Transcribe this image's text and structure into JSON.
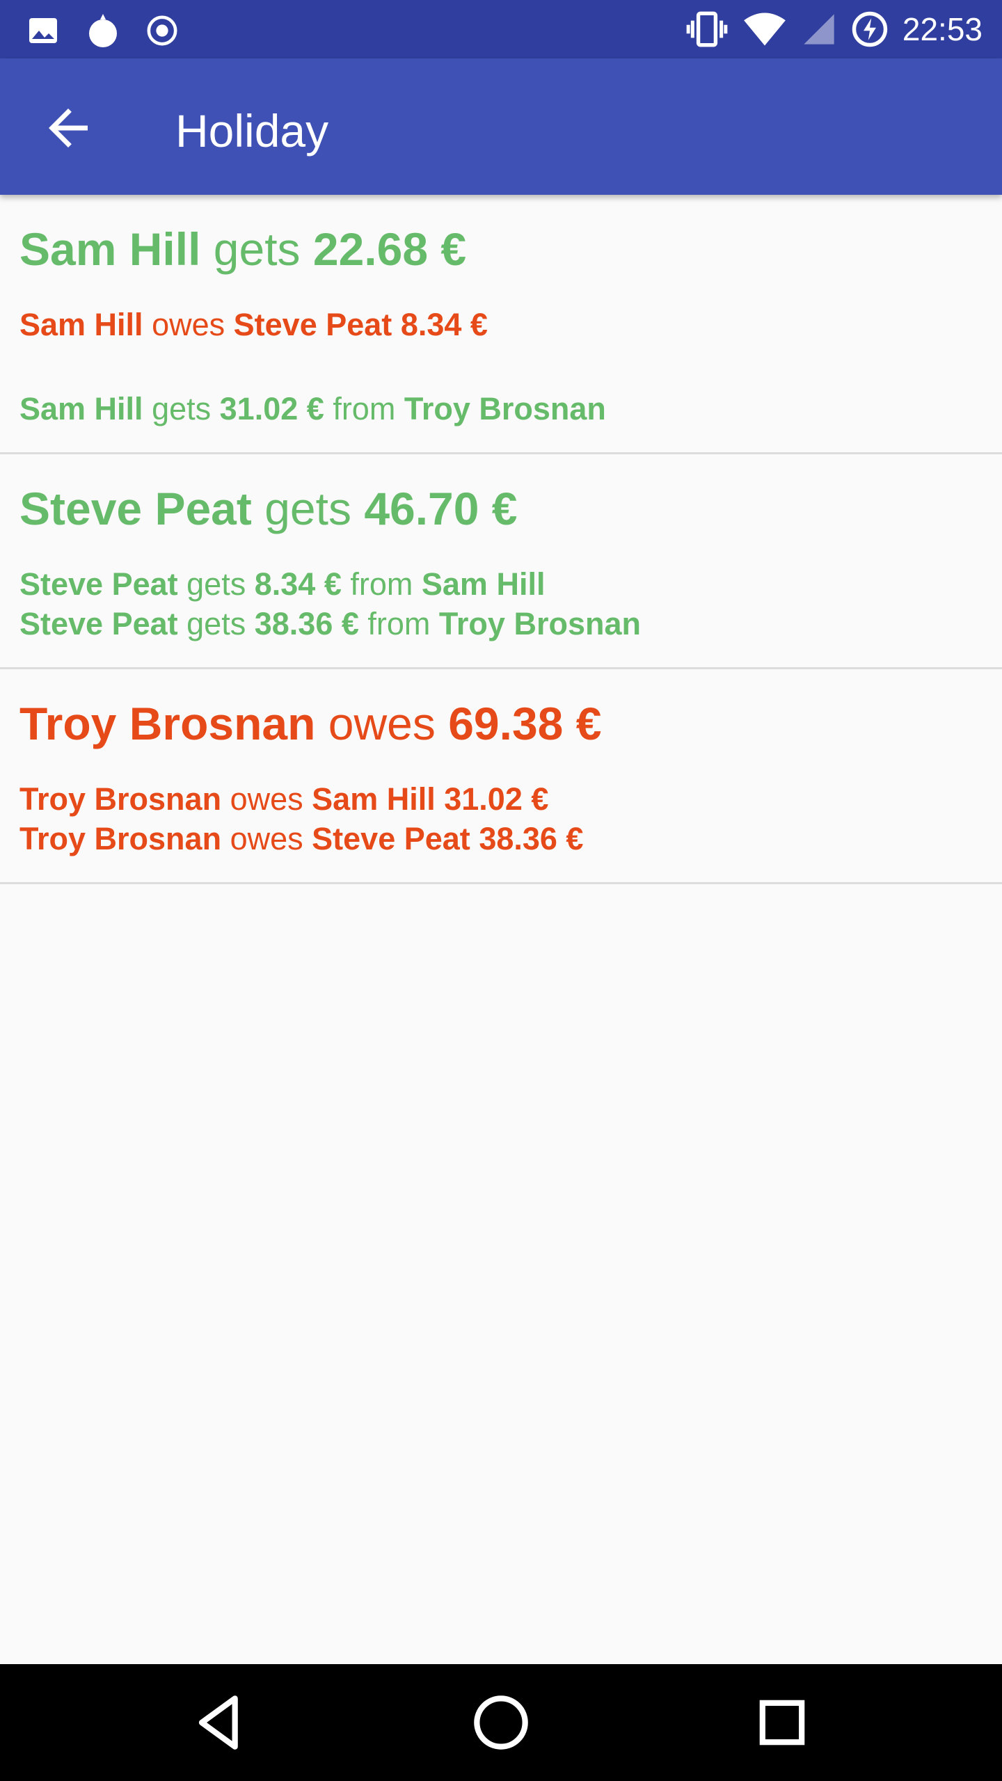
{
  "status_bar": {
    "time": "22:53",
    "left_icons": [
      "image-icon",
      "pomegranate-icon",
      "record-icon"
    ],
    "right_icons": [
      "vibrate-icon",
      "wifi-icon",
      "signal-icon",
      "battery-charging-icon"
    ]
  },
  "app_bar": {
    "title": "Holiday",
    "back_icon": "arrow-back-icon"
  },
  "colors": {
    "positive": "#66bb6a",
    "negative": "#e64a19",
    "primary": "#3f51b5",
    "primary_dark": "#303f9f"
  },
  "settlements": [
    {
      "summary": {
        "name": "Sam Hill",
        "verb": "gets",
        "amount": "22.68 €"
      },
      "details": [
        {
          "name": "Sam Hill",
          "verb": "owes",
          "other": "Steve Peat",
          "amount": "8.34 €"
        },
        {
          "name": "Sam Hill",
          "verb": "gets",
          "amount": "31.02 €",
          "from": "from",
          "other": "Troy Brosnan"
        }
      ]
    },
    {
      "summary": {
        "name": "Steve Peat",
        "verb": "gets",
        "amount": "46.70 €"
      },
      "details": [
        {
          "name": "Steve Peat",
          "verb": "gets",
          "amount": "8.34 €",
          "from": "from",
          "other": "Sam Hill"
        },
        {
          "name": "Steve Peat",
          "verb": "gets",
          "amount": "38.36 €",
          "from": "from",
          "other": "Troy Brosnan"
        }
      ]
    },
    {
      "summary": {
        "name": "Troy Brosnan",
        "verb": "owes",
        "amount": "69.38 €"
      },
      "details": [
        {
          "name": "Troy Brosnan",
          "verb": "owes",
          "other": "Sam Hill",
          "amount": "31.02 €"
        },
        {
          "name": "Troy Brosnan",
          "verb": "owes",
          "other": "Steve Peat",
          "amount": "38.36 €"
        }
      ]
    }
  ],
  "nav_bar": {
    "buttons": [
      "back-triangle-icon",
      "home-circle-icon",
      "recents-square-icon"
    ]
  }
}
